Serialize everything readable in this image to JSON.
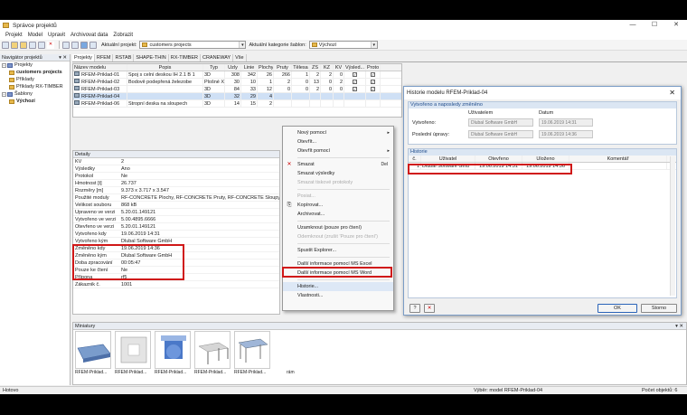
{
  "window": {
    "title": "Správce projektů",
    "minimize_glyph": "—",
    "maximize_glyph": "☐",
    "close_glyph": "✕"
  },
  "menu": [
    "Projekt",
    "Model",
    "Upravit",
    "Archivovat data",
    "Zobrazit"
  ],
  "toolbar": {
    "project_label": "Aktuální projekt:",
    "project_value": "customers projects",
    "category_label": "Aktuální kategorie šablon:",
    "category_value": "Výchozí"
  },
  "navigator": {
    "title": "Navigátor projektů",
    "pin": "▾ ✕",
    "items": [
      {
        "label": "Projekty"
      },
      {
        "label": "customers projects"
      },
      {
        "label": "Příklady"
      },
      {
        "label": "Příklady RX-TIMBER"
      },
      {
        "label": "Šablony"
      },
      {
        "label": "Výchozí"
      }
    ]
  },
  "tabs": [
    "Projekty",
    "RFEM",
    "RSTAB",
    "SHAPE-THIN",
    "RX-TIMBER",
    "CRANEWAY",
    "Vše"
  ],
  "grid": {
    "headers": [
      "Název modelu",
      "Popis",
      "Typ",
      "Uzly",
      "Linie",
      "Plochy",
      "Pruty",
      "Tělesa",
      "ZS",
      "KZ",
      "KV",
      "Výsled...",
      "Proto"
    ],
    "rows": [
      [
        "RFEM-Priklad-01",
        "Spoj s celní deskou IH 2.1 B 1",
        "3D",
        "308",
        "342",
        "26",
        "266",
        "1",
        "2",
        "2",
        "0",
        "✓",
        "✓"
      ],
      [
        "RFEM-Priklad-02",
        "Bodově podepřená železobe",
        "Plošné XY",
        "30",
        "10",
        "1",
        "2",
        "0",
        "13",
        "0",
        "2",
        "✓",
        "✓"
      ],
      [
        "RFEM-Priklad-03",
        "",
        "3D",
        "84",
        "33",
        "12",
        "0",
        "0",
        "2",
        "0",
        "0",
        "✓",
        "✓"
      ],
      [
        "RFEM-Priklad-04",
        "",
        "3D",
        "32",
        "29",
        "4",
        "",
        "",
        "",
        "",
        "",
        "",
        ""
      ],
      [
        "RFEM-Priklad-06",
        "Stropní deska na sloupech",
        "3D",
        "14",
        "15",
        "2",
        "",
        "",
        "",
        "",
        "",
        "",
        ""
      ]
    ]
  },
  "details": {
    "title": "Detaily",
    "pin": "▾ ✕",
    "rows": [
      [
        "KV",
        "2"
      ],
      [
        "Výsledky",
        "Ano"
      ],
      [
        "Protokol",
        "Ne"
      ],
      [
        "Hmotnost [t]",
        "26.737"
      ],
      [
        "Rozměry [m]",
        "9.373 x 3.717 x 3.547"
      ],
      [
        "Použité moduly",
        "RF-CONCRETE Plochy, RF-CONCRETE Pruty, RF-CONCRETE Sloupy"
      ],
      [
        "Velikost souboru",
        "868 kB"
      ],
      [
        "Upraveno ve verzi",
        "5.20.01.149121"
      ],
      [
        "Vytvořeno ve verzi",
        "5.00.4895.6666"
      ],
      [
        "Otevřeno ve verzi",
        "5.20.01.149121"
      ],
      [
        "Vytvořeno kdy",
        "19.06.2019 14:31"
      ],
      [
        "Vytvořeno kým",
        "Dlubal Software GmbH"
      ],
      [
        "Změněno kdy",
        "19.06.2019 14:36"
      ],
      [
        "Změněno kým",
        "Dlubal Software GmbH"
      ],
      [
        "Doba zpracování",
        "00:05:47"
      ],
      [
        "Pouze ke čtení",
        "Ne"
      ],
      [
        "Přípona",
        "rf5"
      ],
      [
        "Zákaznik č.",
        "1001"
      ]
    ]
  },
  "context_menu": {
    "items": [
      {
        "label": "Nový pomocí",
        "sub": "▸",
        "disabled": false,
        "icon": ""
      },
      {
        "label": "Otevřít...",
        "disabled": false,
        "icon": ""
      },
      {
        "label": "Otevřít pomocí",
        "sub": "▸",
        "disabled": false,
        "icon": ""
      },
      {
        "sep": true
      },
      {
        "label": "Smazat",
        "shortcut": "Del",
        "disabled": false,
        "icon": "✕"
      },
      {
        "label": "Smazat výsledky",
        "disabled": false,
        "icon": ""
      },
      {
        "label": "Smazat tiskové protokoly",
        "disabled": true,
        "icon": ""
      },
      {
        "sep": true
      },
      {
        "label": "Posiat...",
        "disabled": true,
        "icon": ""
      },
      {
        "label": "Kopírovat...",
        "disabled": false,
        "icon": "⎘"
      },
      {
        "label": "Archivovat...",
        "disabled": false,
        "icon": ""
      },
      {
        "sep": true
      },
      {
        "label": "Uzamknout (pouze pro čtení)",
        "disabled": false,
        "icon": ""
      },
      {
        "label": "Odemknout (zrušit 'Pouze pro čtení')",
        "disabled": true,
        "icon": ""
      },
      {
        "sep": true
      },
      {
        "label": "Spustit Explorer...",
        "disabled": false,
        "icon": ""
      },
      {
        "sep": true
      },
      {
        "label": "Další informace pomocí MS Excel",
        "disabled": false,
        "icon": ""
      },
      {
        "label": "Další informace pomocí MS Word",
        "disabled": false,
        "icon": ""
      },
      {
        "sep": true
      },
      {
        "label": "Historie...",
        "disabled": false,
        "icon": "",
        "highlight": true
      },
      {
        "label": "Vlastnosti...",
        "disabled": false,
        "icon": ""
      }
    ]
  },
  "dialog": {
    "title": "Historie modelu RFEM-Priklad-04",
    "close": "✕",
    "created_group": "Vytvořeno a naposledy změněno",
    "col_user": "Uživatelem",
    "col_date": "Datum",
    "created_label": "Vytvořeno:",
    "created_user": "Dlubal Software GmbH",
    "created_date": "19.06.2019 14:31",
    "changed_label": "Poslední úpravy:",
    "changed_user": "Dlubal Software GmbH",
    "changed_date": "19.06.2019 14:36",
    "history_group": "Historie",
    "hist_headers": [
      "č.",
      "Uživatel",
      "Otevřeno",
      "Uloženo",
      "Komentář"
    ],
    "hist_rows": [
      [
        "1",
        "Dlubal Software Gmb",
        "19.06.2019 14:31",
        "19.06.2019 14:36",
        ""
      ]
    ],
    "ok": "OK",
    "cancel": "Storno"
  },
  "thumbnails": {
    "title": "Miniatury",
    "pin": "▾ ✕",
    "items": [
      "RFEM-Priklad...",
      "RFEM-Priklad...",
      "RFEM-Priklad...",
      "RFEM-Priklad...",
      "RFEM-Priklad...",
      "rám"
    ]
  },
  "status": {
    "left": "Hotovo",
    "middle": "Výběr: model RFEM-Priklad-04",
    "right": "Počet objektů: 6"
  },
  "colors": {
    "highlight": "#d01818",
    "accent": "#2a63b8"
  }
}
